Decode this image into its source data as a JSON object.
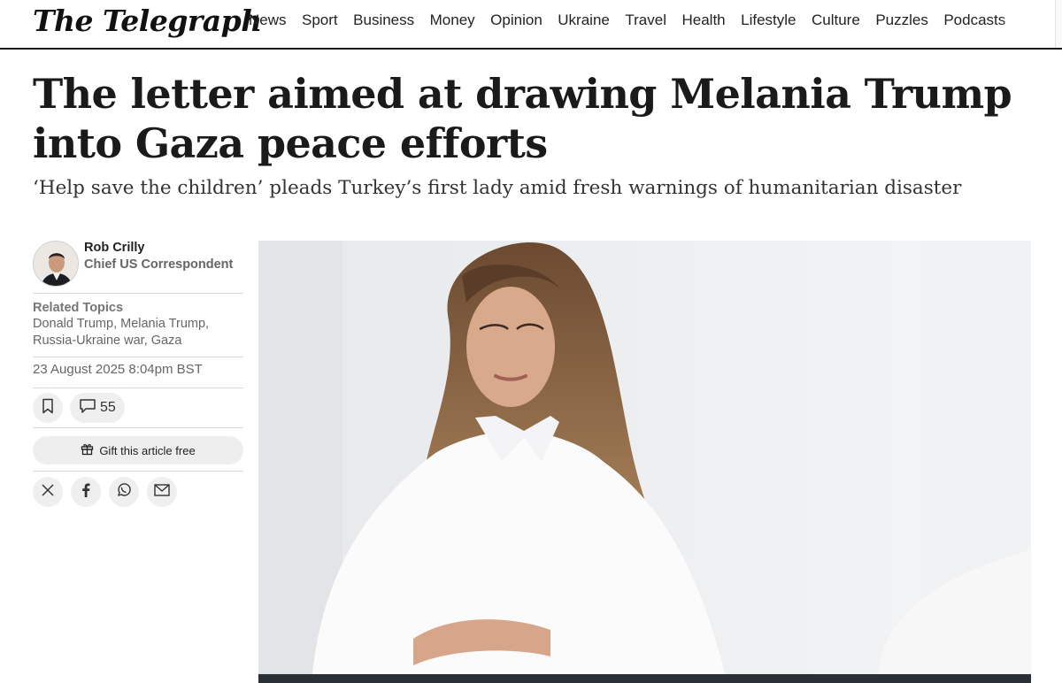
{
  "masthead": {
    "logo": "The Telegraph",
    "nav": [
      "News",
      "Sport",
      "Business",
      "Money",
      "Opinion",
      "Ukraine",
      "Travel",
      "Health",
      "Lifestyle",
      "Culture",
      "Puzzles",
      "Podcasts"
    ]
  },
  "article": {
    "headline": "The letter aimed at drawing Melania Trump into Gaza peace efforts",
    "standfirst": "‘Help save the children’ pleads Turkey’s first lady amid fresh warnings of humanitarian disaster",
    "author": {
      "name": "Rob Crilly",
      "role": "Chief US Correspondent"
    },
    "related_label": "Related Topics",
    "related_topics": "Donald Trump, Melania Trump, Russia-Ukraine war, Gaza",
    "date": "23 August 2025 8:04pm BST",
    "comment_count": "55",
    "gift_label": "Gift this article free"
  },
  "icons": {
    "bookmark": "bookmark-icon",
    "comment": "comment-icon",
    "gift": "gift-icon",
    "share": [
      "x-icon",
      "facebook-icon",
      "whatsapp-icon",
      "email-icon"
    ]
  }
}
